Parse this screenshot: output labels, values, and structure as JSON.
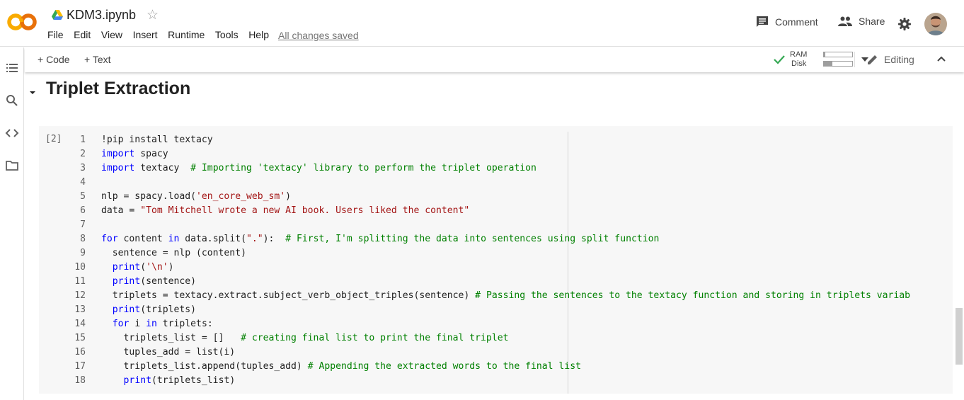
{
  "app": {
    "logo_text": "CO",
    "filename": "KDM3.ipynb",
    "save_status": "All changes saved",
    "menu": [
      "File",
      "Edit",
      "View",
      "Insert",
      "Runtime",
      "Tools",
      "Help"
    ],
    "header_buttons": {
      "comment": "Comment",
      "share": "Share"
    }
  },
  "toolbar": {
    "add_code": "+ Code",
    "add_text": "+ Text",
    "ram_label": "RAM",
    "disk_label": "Disk",
    "ram_usage": 0.05,
    "disk_usage": 0.3,
    "mode": "Editing"
  },
  "section": {
    "title": "Triplet Extraction"
  },
  "cell": {
    "execution_count": "[2]",
    "lines": [
      {
        "n": "1",
        "segs": [
          [
            "t",
            "!pip install textacy"
          ]
        ]
      },
      {
        "n": "2",
        "segs": [
          [
            "kw",
            "import"
          ],
          [
            "t",
            " spacy"
          ]
        ]
      },
      {
        "n": "3",
        "segs": [
          [
            "kw",
            "import"
          ],
          [
            "t",
            " textacy  "
          ],
          [
            "cm",
            "# Importing 'textacy' library to perform the triplet operation"
          ]
        ]
      },
      {
        "n": "4",
        "segs": []
      },
      {
        "n": "5",
        "segs": [
          [
            "t",
            "nlp = spacy.load("
          ],
          [
            "str",
            "'en_core_web_sm'"
          ],
          [
            "t",
            ")"
          ]
        ]
      },
      {
        "n": "6",
        "segs": [
          [
            "t",
            "data = "
          ],
          [
            "str",
            "\"Tom Mitchell wrote a new AI book. Users liked the content\""
          ]
        ]
      },
      {
        "n": "7",
        "segs": []
      },
      {
        "n": "8",
        "segs": [
          [
            "kw",
            "for"
          ],
          [
            "t",
            " content "
          ],
          [
            "kw",
            "in"
          ],
          [
            "t",
            " data.split("
          ],
          [
            "str",
            "\".\""
          ],
          [
            "t",
            "):  "
          ],
          [
            "cm",
            "# First, I'm splitting the data into sentences using split function"
          ]
        ]
      },
      {
        "n": "9",
        "segs": [
          [
            "t",
            "  sentence = nlp (content)"
          ]
        ]
      },
      {
        "n": "10",
        "segs": [
          [
            "t",
            "  "
          ],
          [
            "kw",
            "print"
          ],
          [
            "t",
            "("
          ],
          [
            "str",
            "'\\n'"
          ],
          [
            "t",
            ")"
          ]
        ]
      },
      {
        "n": "11",
        "segs": [
          [
            "t",
            "  "
          ],
          [
            "kw",
            "print"
          ],
          [
            "t",
            "(sentence)"
          ]
        ]
      },
      {
        "n": "12",
        "segs": [
          [
            "t",
            "  triplets = textacy.extract.subject_verb_object_triples(sentence) "
          ],
          [
            "cm",
            "# Passing the sentences to the textacy function and storing in triplets variab"
          ]
        ]
      },
      {
        "n": "13",
        "segs": [
          [
            "t",
            "  "
          ],
          [
            "kw",
            "print"
          ],
          [
            "t",
            "(triplets)"
          ]
        ]
      },
      {
        "n": "14",
        "segs": [
          [
            "t",
            "  "
          ],
          [
            "kw",
            "for"
          ],
          [
            "t",
            " i "
          ],
          [
            "kw",
            "in"
          ],
          [
            "t",
            " triplets:"
          ]
        ]
      },
      {
        "n": "15",
        "segs": [
          [
            "t",
            "    triplets_list = []   "
          ],
          [
            "cm",
            "# creating final list to print the final triplet"
          ]
        ]
      },
      {
        "n": "16",
        "segs": [
          [
            "t",
            "    tuples_add = list(i)"
          ]
        ]
      },
      {
        "n": "17",
        "segs": [
          [
            "t",
            "    triplets_list.append(tuples_add) "
          ],
          [
            "cm",
            "# Appending the extracted words to the final list"
          ]
        ]
      },
      {
        "n": "18",
        "segs": [
          [
            "t",
            "    "
          ],
          [
            "kw",
            "print"
          ],
          [
            "t",
            "(triplets_list)"
          ]
        ]
      }
    ]
  },
  "icons": {
    "sidebar": [
      "table-of-contents-icon",
      "search-icon",
      "code-snippets-icon",
      "files-icon"
    ],
    "colors": {
      "logo_orange": "#f9ab00",
      "logo_dark_orange": "#e8710a",
      "check_green": "#34a853",
      "keyword": "#0000ff",
      "string": "#a31515",
      "comment": "#008000"
    }
  }
}
